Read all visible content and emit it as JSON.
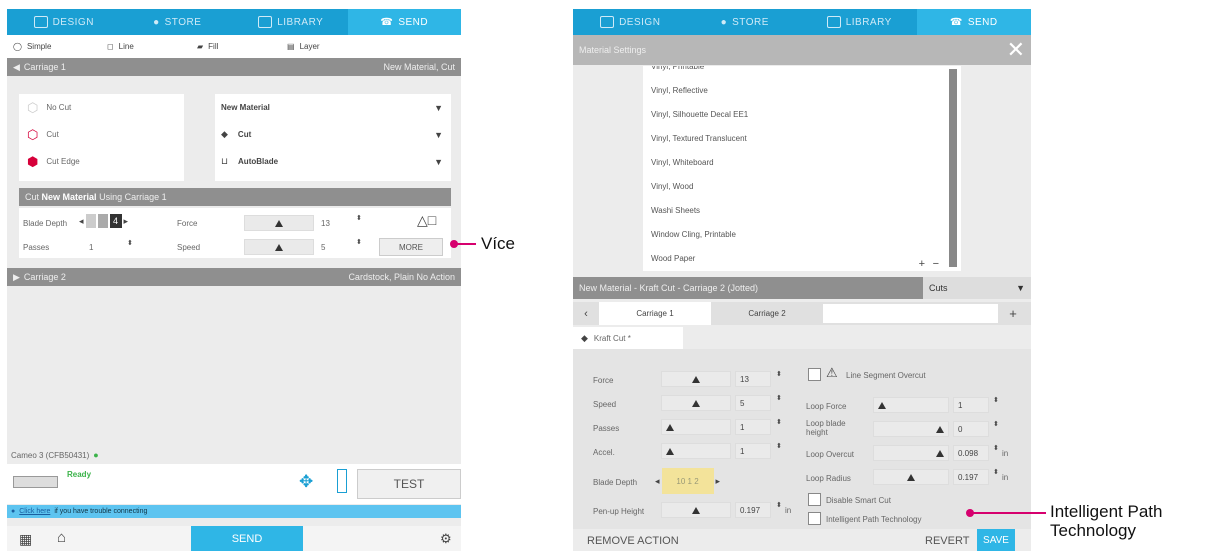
{
  "left": {
    "tabs": [
      "DESIGN",
      "STORE",
      "LIBRARY",
      "SEND"
    ],
    "modes": [
      "Simple",
      "Line",
      "Fill",
      "Layer"
    ],
    "carriage1": {
      "label": "Carriage 1",
      "right": "New Material, Cut"
    },
    "cut_options": [
      "No Cut",
      "Cut",
      "Cut Edge"
    ],
    "material": "New Material",
    "action": "Cut",
    "tool": "AutoBlade",
    "summary_prefix": "Cut",
    "summary_bold": "New Material",
    "summary_suffix": "Using Carriage 1",
    "blade_depth_label": "Blade Depth",
    "blade_depth_value": "4",
    "passes_label": "Passes",
    "passes_value": "1",
    "force_label": "Force",
    "force_value": "13",
    "speed_label": "Speed",
    "speed_value": "5",
    "more_label": "MORE",
    "carriage2": {
      "label": "Carriage 2",
      "right": "Cardstock, Plain No Action"
    },
    "device": "Cameo 3 (CFB50431)",
    "status": "Ready",
    "test_label": "TEST",
    "help_link": "Click here",
    "help_text": "if you have trouble connecting",
    "send_label": "SEND"
  },
  "right": {
    "tabs": [
      "DESIGN",
      "STORE",
      "LIBRARY",
      "SEND"
    ],
    "material_settings": "Material Settings",
    "materials": [
      "Vinyl, Printable",
      "Vinyl, Reflective",
      "Vinyl, Silhouette Decal EE1",
      "Vinyl, Textured Translucent",
      "Vinyl, Whiteboard",
      "Vinyl, Wood",
      "Washi Sheets",
      "Window Cling, Printable",
      "Wood Paper"
    ],
    "header": "New Material - Kraft Cut - Carriage 2 (Jotted)",
    "header_select": "Cuts",
    "carriage_tabs": [
      "Carriage 1",
      "Carriage 2"
    ],
    "kraft_tab": "Kraft Cut *",
    "force_label": "Force",
    "force_value": "13",
    "speed_label": "Speed",
    "speed_value": "5",
    "passes_label": "Passes",
    "passes_value": "1",
    "accel_label": "Accel.",
    "accel_value": "1",
    "blade_depth_label": "Blade Depth",
    "blade_depth_value": "10 1 2",
    "penup_label": "Pen-up Height",
    "penup_value": "0.197",
    "penup_unit": "in",
    "line_segment": "Line Segment Overcut",
    "loop_force_label": "Loop Force",
    "loop_force_value": "1",
    "loop_blade_label": "Loop blade height",
    "loop_blade_value": "0",
    "loop_overcut_label": "Loop Overcut",
    "loop_overcut_value": "0.098",
    "loop_radius_label": "Loop Radius",
    "loop_radius_value": "0.197",
    "unit": "in",
    "disable_smart": "Disable Smart Cut",
    "intelligent": "Intelligent Path Technology",
    "remove": "REMOVE ACTION",
    "revert": "REVERT",
    "save": "SAVE"
  },
  "callouts": {
    "more": "Více",
    "intelligent": "Intelligent Path Technology"
  },
  "colors": {
    "nav": "#1a9fd3",
    "nav_active": "#2fb6e6",
    "bar": "#8f8f8f",
    "callout": "#d6006e",
    "blade_highlight": "#f3e39a"
  }
}
